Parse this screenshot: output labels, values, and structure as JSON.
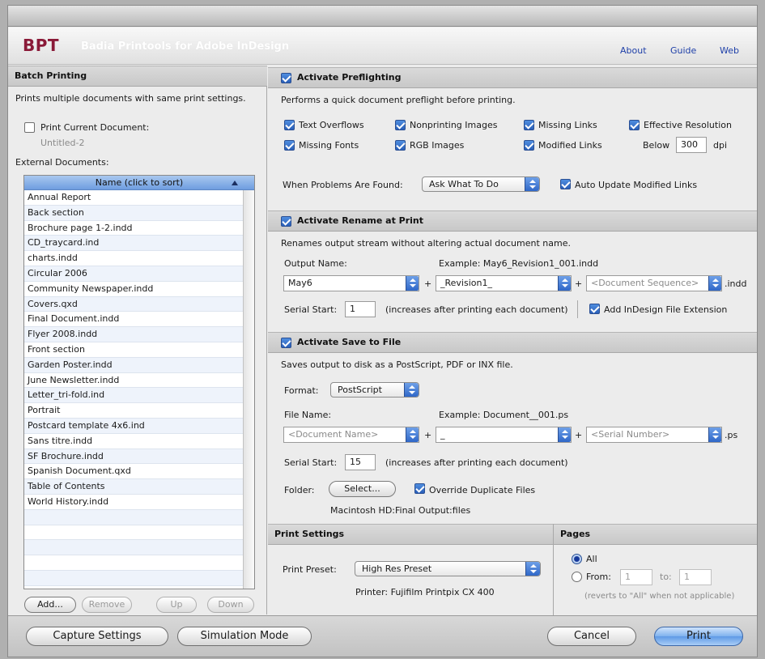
{
  "brand": {
    "short": "BPT",
    "full": "Badia Printools for Adobe InDesign",
    "links": [
      "About",
      "Guide",
      "Web"
    ]
  },
  "batch": {
    "header": "Batch Printing",
    "description": "Prints multiple documents with same print settings.",
    "print_current_label": "Print Current Document:",
    "current_doc": "Untitled-2",
    "external_label": "External Documents:",
    "column_header": "Name (click to sort)",
    "documents": [
      "Annual Report",
      "Back section",
      "Brochure page 1-2.indd",
      "CD_traycard.ind",
      "charts.indd",
      "Circular 2006",
      "Community Newspaper.indd",
      "Covers.qxd",
      "Final Document.indd",
      "Flyer 2008.indd",
      "Front section",
      "Garden Poster.indd",
      "June Newsletter.indd",
      "Letter_tri-fold.ind",
      "Portrait",
      "Postcard template 4x6.ind",
      "Sans titre.indd",
      "SF Brochure.indd",
      "Spanish Document.qxd",
      "Table of Contents",
      "World History.indd",
      "",
      "",
      "",
      "",
      ""
    ],
    "buttons": {
      "add": "Add...",
      "remove": "Remove",
      "up": "Up",
      "down": "Down"
    }
  },
  "preflight": {
    "header": "Activate Preflighting",
    "description": "Performs a quick document preflight before printing.",
    "checks": {
      "text_overflows": "Text Overflows",
      "nonprinting_images": "Nonprinting Images",
      "missing_links": "Missing Links",
      "effective_resolution": "Effective Resolution",
      "missing_fonts": "Missing Fonts",
      "rgb_images": "RGB Images",
      "modified_links": "Modified Links"
    },
    "below_label": "Below",
    "dpi_value": "300",
    "dpi_label": "dpi",
    "problems_label": "When Problems Are Found:",
    "problems_value": "Ask What To Do",
    "auto_update_label": "Auto Update Modified Links"
  },
  "rename": {
    "header": "Activate Rename at Print",
    "description": "Renames output stream without altering actual document name.",
    "output_label": "Output Name:",
    "example": "Example: May6_Revision1_001.indd",
    "part1": "May6",
    "part2": "_Revision1_",
    "part3": "<Document Sequence>",
    "plus": "+",
    "ext": ".indd",
    "serial_label": "Serial Start:",
    "serial_value": "1",
    "serial_note": "(increases after printing each document)",
    "add_ext_label": "Add InDesign File Extension"
  },
  "save": {
    "header": "Activate Save to File",
    "description": "Saves output to disk as a PostScript, PDF or INX file.",
    "format_label": "Format:",
    "format_value": "PostScript",
    "filename_label": "File Name:",
    "example": "Example: Document__001.ps",
    "part1": "<Document Name>",
    "part2": "_",
    "part3": "<Serial Number>",
    "plus": "+",
    "ext": ".ps",
    "serial_label": "Serial Start:",
    "serial_value": "15",
    "serial_note": "(increases after printing each document)",
    "folder_label": "Folder:",
    "select_button": "Select...",
    "override_label": "Override Duplicate Files",
    "folder_path": "Macintosh HD:Final Output:files"
  },
  "print_settings": {
    "header": "Print Settings",
    "preset_label": "Print Preset:",
    "preset_value": "High Res Preset",
    "printer": "Printer: Fujifilm Printpix CX 400"
  },
  "pages": {
    "header": "Pages",
    "all_label": "All",
    "from_label": "From:",
    "from_value": "1",
    "to_label": "to:",
    "to_value": "1",
    "note": "(reverts to \"All\" when not applicable)"
  },
  "footer": {
    "capture": "Capture Settings",
    "simulation": "Simulation Mode",
    "cancel": "Cancel",
    "print": "Print"
  }
}
